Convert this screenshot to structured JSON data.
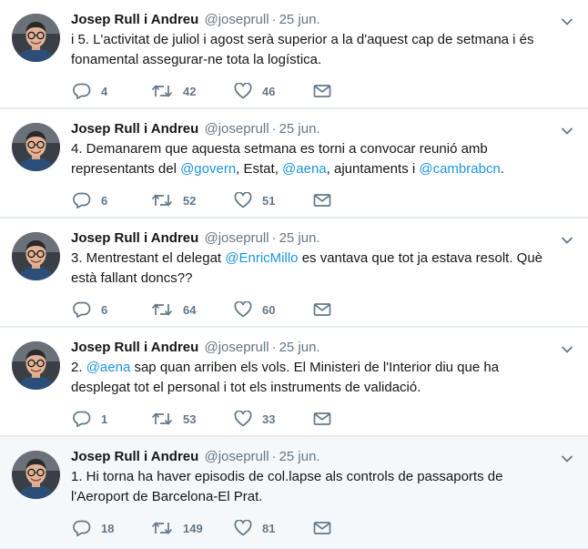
{
  "tweets": [
    {
      "author": "Josep Rull i Andreu",
      "handle": "@joseprull",
      "time": "25 jun.",
      "text_parts": [
        {
          "t": "i 5. L'activitat de juliol i agost serà superior a la d'aquest cap de setmana i és fonamental assegurar-ne tota la logística.",
          "mention": false
        }
      ],
      "replies": "4",
      "retweets": "42",
      "likes": "46"
    },
    {
      "author": "Josep Rull i Andreu",
      "handle": "@joseprull",
      "time": "25 jun.",
      "text_parts": [
        {
          "t": "4. Demanarem que aquesta setmana es torni a convocar reunió amb representants del ",
          "mention": false
        },
        {
          "t": "@govern",
          "mention": true
        },
        {
          "t": ", Estat, ",
          "mention": false
        },
        {
          "t": "@aena",
          "mention": true
        },
        {
          "t": ", ajuntaments i ",
          "mention": false
        },
        {
          "t": "@cambrabcn",
          "mention": true
        },
        {
          "t": ".",
          "mention": false
        }
      ],
      "replies": "6",
      "retweets": "52",
      "likes": "51"
    },
    {
      "author": "Josep Rull i Andreu",
      "handle": "@joseprull",
      "time": "25 jun.",
      "text_parts": [
        {
          "t": "3. Mentrestant el delegat ",
          "mention": false
        },
        {
          "t": "@EnricMillo",
          "mention": true
        },
        {
          "t": " es vantava que tot ja estava resolt. Què està fallant doncs??",
          "mention": false
        }
      ],
      "replies": "6",
      "retweets": "64",
      "likes": "60"
    },
    {
      "author": "Josep Rull i Andreu",
      "handle": "@joseprull",
      "time": "25 jun.",
      "text_parts": [
        {
          "t": "2. ",
          "mention": false
        },
        {
          "t": "@aena",
          "mention": true
        },
        {
          "t": " sap quan arriben els vols. El Ministeri de l'Interior diu que ha desplegat tot el personal i tot els instruments de validació.",
          "mention": false
        }
      ],
      "replies": "1",
      "retweets": "53",
      "likes": "33"
    },
    {
      "author": "Josep Rull i Andreu",
      "handle": "@joseprull",
      "time": "25 jun.",
      "text_parts": [
        {
          "t": "1. Hi torna ha haver episodis de col.lapse als controls de passaports de l'Aeroport de Barcelona-El Prat.",
          "mention": false
        }
      ],
      "replies": "18",
      "retweets": "149",
      "likes": "81"
    }
  ],
  "colors": {
    "text": "#14171a",
    "secondary": "#657786",
    "link": "#1b95e0",
    "divider": "#e6ecf0",
    "highlight_bg": "#f5f8fa"
  },
  "icons": {
    "reply": "reply-icon",
    "retweet": "retweet-icon",
    "like": "heart-icon",
    "dm": "envelope-icon",
    "menu": "chevron-down-icon"
  }
}
